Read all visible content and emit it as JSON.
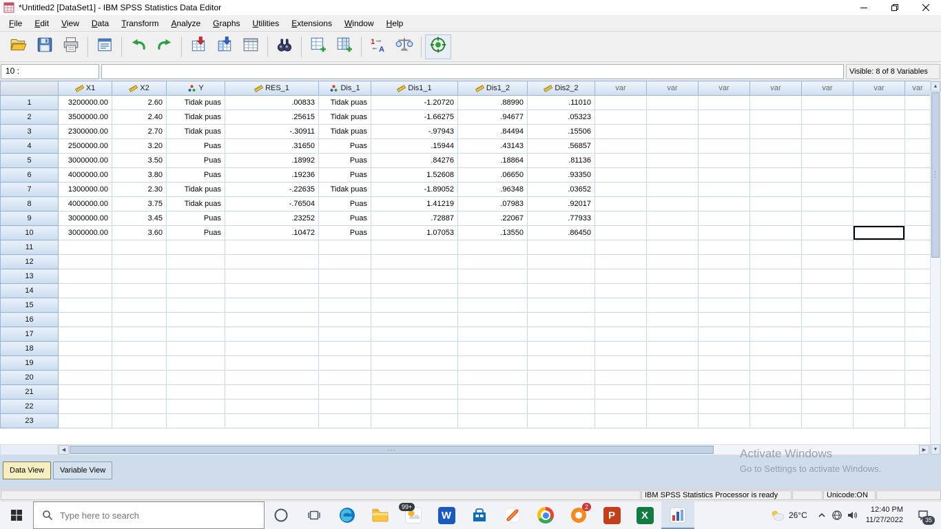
{
  "window": {
    "title": "*Untitled2 [DataSet1] - IBM SPSS Statistics Data Editor"
  },
  "menubar": {
    "items": [
      "File",
      "Edit",
      "View",
      "Data",
      "Transform",
      "Analyze",
      "Graphs",
      "Utilities",
      "Extensions",
      "Window",
      "Help"
    ]
  },
  "toolbar": {
    "buttons": [
      "open-data",
      "save",
      "print",
      "recall-dialogs",
      "undo",
      "redo",
      "goto-case",
      "goto-variable",
      "variables",
      "find",
      "insert-cases",
      "insert-variable",
      "value-labels",
      "weight-cases",
      "select-cases"
    ]
  },
  "cell_reference": {
    "label": "10 :",
    "editor_value": "",
    "visible_info": "Visible: 8 of 8 Variables"
  },
  "grid": {
    "columns": [
      {
        "label": "X1",
        "measure": "scale"
      },
      {
        "label": "X2",
        "measure": "scale"
      },
      {
        "label": "Y",
        "measure": "nominal"
      },
      {
        "label": "RES_1",
        "measure": "scale"
      },
      {
        "label": "Dis_1",
        "measure": "nominal"
      },
      {
        "label": "Dis1_1",
        "measure": "scale"
      },
      {
        "label": "Dis1_2",
        "measure": "scale"
      },
      {
        "label": "Dis2_2",
        "measure": "scale"
      },
      {
        "label": "var",
        "measure": "none"
      },
      {
        "label": "var",
        "measure": "none"
      },
      {
        "label": "var",
        "measure": "none"
      },
      {
        "label": "var",
        "measure": "none"
      },
      {
        "label": "var",
        "measure": "none"
      },
      {
        "label": "var",
        "measure": "none"
      },
      {
        "label": "var",
        "measure": "none"
      }
    ],
    "rows": [
      {
        "n": 1,
        "values": [
          "3200000.00",
          "2.60",
          "Tidak puas",
          ".00833",
          "Tidak puas",
          "-1.20720",
          ".88990",
          ".11010"
        ]
      },
      {
        "n": 2,
        "values": [
          "3500000.00",
          "2.40",
          "Tidak puas",
          ".25615",
          "Tidak puas",
          "-1.66275",
          ".94677",
          ".05323"
        ]
      },
      {
        "n": 3,
        "values": [
          "2300000.00",
          "2.70",
          "Tidak puas",
          "-.30911",
          "Tidak puas",
          "-.97943",
          ".84494",
          ".15506"
        ]
      },
      {
        "n": 4,
        "values": [
          "2500000.00",
          "3.20",
          "Puas",
          ".31650",
          "Puas",
          ".15944",
          ".43143",
          ".56857"
        ]
      },
      {
        "n": 5,
        "values": [
          "3000000.00",
          "3.50",
          "Puas",
          ".18992",
          "Puas",
          ".84276",
          ".18864",
          ".81136"
        ]
      },
      {
        "n": 6,
        "values": [
          "4000000.00",
          "3.80",
          "Puas",
          ".19236",
          "Puas",
          "1.52608",
          ".06650",
          ".93350"
        ]
      },
      {
        "n": 7,
        "values": [
          "1300000.00",
          "2.30",
          "Tidak puas",
          "-.22635",
          "Tidak puas",
          "-1.89052",
          ".96348",
          ".03652"
        ]
      },
      {
        "n": 8,
        "values": [
          "4000000.00",
          "3.75",
          "Tidak puas",
          "-.76504",
          "Puas",
          "1.41219",
          ".07983",
          ".92017"
        ]
      },
      {
        "n": 9,
        "values": [
          "3000000.00",
          "3.45",
          "Puas",
          ".23252",
          "Puas",
          ".72887",
          ".22067",
          ".77933"
        ]
      },
      {
        "n": 10,
        "values": [
          "3000000.00",
          "3.60",
          "Puas",
          ".10472",
          "Puas",
          "1.07053",
          ".13550",
          ".86450"
        ]
      }
    ],
    "last_visible_row": 23,
    "selection": {
      "row": 10,
      "column_label": "var",
      "column_index": 13
    }
  },
  "tabs": [
    {
      "label": "Data View",
      "active": true
    },
    {
      "label": "Variable View",
      "active": false
    }
  ],
  "watermark": {
    "line1": "Activate Windows",
    "line2": "Go to Settings to activate Windows."
  },
  "statusbar": {
    "processor_status": "IBM SPSS Statistics Processor is ready",
    "unicode": "Unicode:ON"
  },
  "taskbar": {
    "search_placeholder": "Type here to search",
    "news_badge": "99+",
    "chat_badge": "2",
    "word_letter": "W",
    "powerpoint_letter": "P",
    "excel_letter": "X",
    "weather": "26°C",
    "time": "12:40 PM",
    "date": "11/27/2022",
    "notification_count": "35"
  }
}
